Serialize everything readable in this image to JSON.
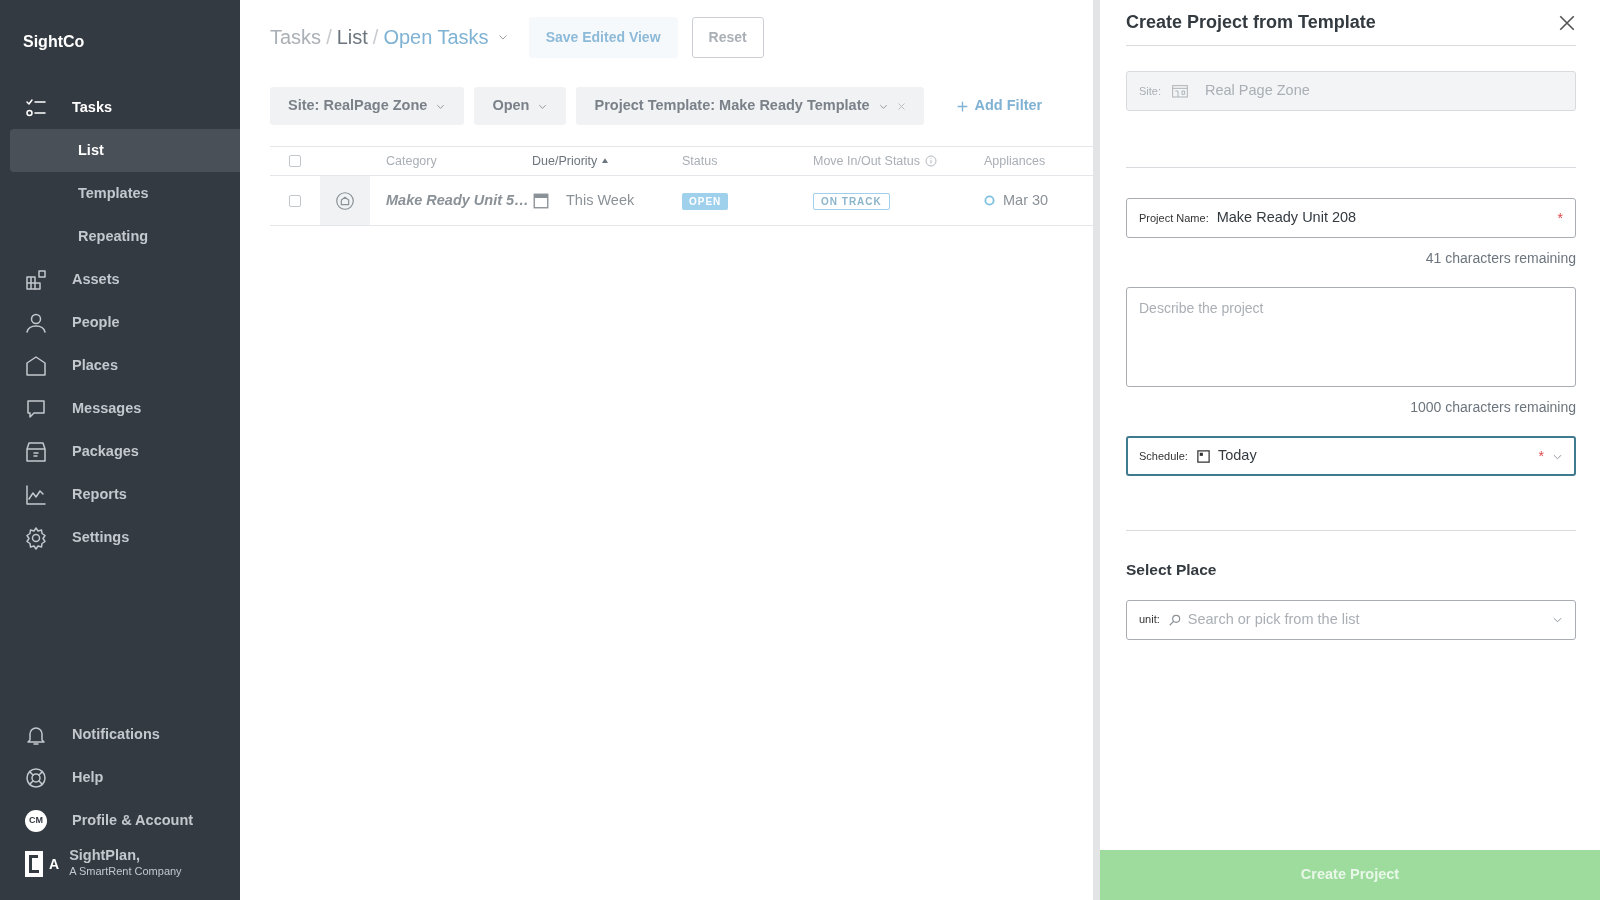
{
  "sidebar": {
    "brand": "SightCo",
    "nav": [
      {
        "label": "Tasks",
        "selected": false,
        "children": [
          {
            "label": "List",
            "selected": true
          },
          {
            "label": "Templates",
            "selected": false
          },
          {
            "label": "Repeating",
            "selected": false
          }
        ]
      },
      {
        "label": "Assets",
        "selected": false
      },
      {
        "label": "People",
        "selected": false
      },
      {
        "label": "Places",
        "selected": false
      },
      {
        "label": "Messages",
        "selected": false
      },
      {
        "label": "Packages",
        "selected": false
      },
      {
        "label": "Reports",
        "selected": false
      },
      {
        "label": "Settings",
        "selected": false
      }
    ],
    "footer_items": [
      {
        "label": "Notifications"
      },
      {
        "label": "Help"
      },
      {
        "label": "Profile & Account",
        "avatar": "CM"
      }
    ],
    "company": {
      "logo_letter": "A",
      "name": "SightPlan,",
      "tagline": "A SmartRent Company"
    }
  },
  "header": {
    "breadcrumb": [
      {
        "label": "Tasks"
      },
      {
        "separator": "/",
        "label": "List"
      },
      {
        "separator": "/",
        "label": "Open Tasks"
      }
    ],
    "save_button": "Save Edited View",
    "reset_button": "Reset"
  },
  "filters": [
    {
      "label": "Site: RealPage Zone",
      "removable": false
    },
    {
      "label": "Open",
      "removable": false
    },
    {
      "label": "Project Template: Make Ready Template",
      "removable": true
    }
  ],
  "add_filter": "Add Filter",
  "table": {
    "all_checked": false,
    "columns": [
      {
        "label": "Category",
        "sorted": false,
        "info": false
      },
      {
        "label": "Due/Priority",
        "sorted": true,
        "info": false
      },
      {
        "label": "Status",
        "sorted": false,
        "info": false
      },
      {
        "label": "Move In/Out Status",
        "sorted": false,
        "info": true
      },
      {
        "label": "Appliances",
        "sorted": false,
        "info": false
      }
    ],
    "rows": [
      {
        "checked": false,
        "category": "Make Ready Unit 5…",
        "due": "This Week",
        "status": "OPEN",
        "move_status": "ON TRACK",
        "appliances": "Mar 30"
      }
    ]
  },
  "panel": {
    "title": "Create Project from Template",
    "site": {
      "label": "Site:",
      "value": "Real Page Zone",
      "disabled": true
    },
    "project_name": {
      "label": "Project Name:",
      "value": "Make Ready Unit 208",
      "required_mark": "*"
    },
    "name_counter": "41 characters remaining",
    "description": {
      "placeholder": "Describe the project"
    },
    "description_counter": "1000 characters remaining",
    "schedule": {
      "label": "Schedule:",
      "value": "Today",
      "required_mark": "*",
      "focused": true
    },
    "place_heading": "Select Place",
    "unit": {
      "label": "unit:",
      "placeholder": "Search or pick from the list"
    },
    "submit": {
      "label": "Create Project",
      "disabled": true
    }
  }
}
